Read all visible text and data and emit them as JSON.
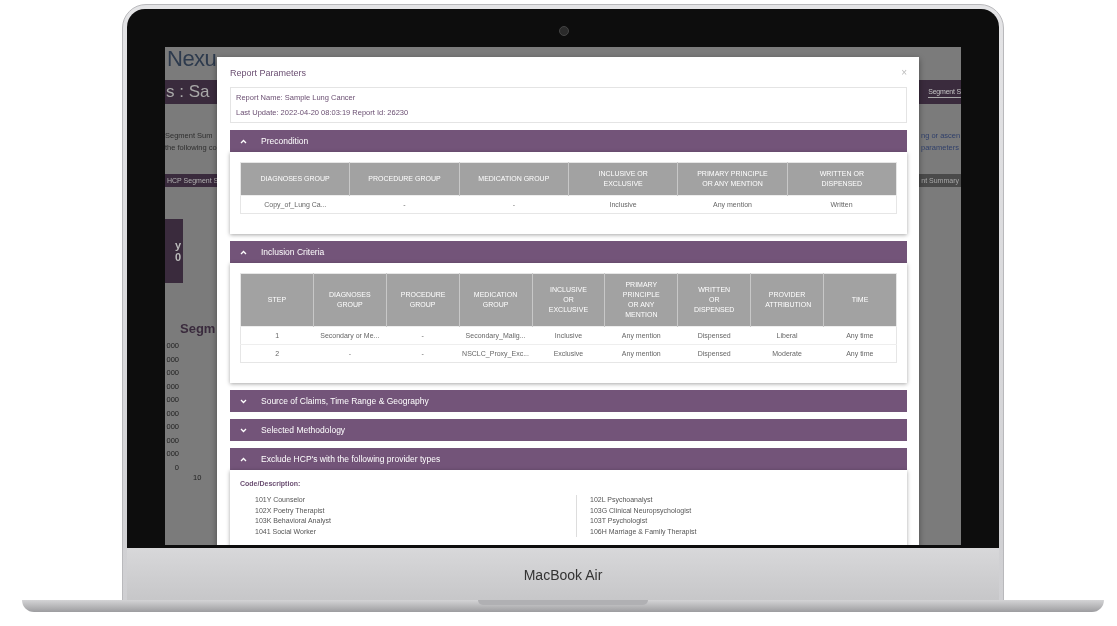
{
  "device": {
    "label": "MacBook Air"
  },
  "background_app": {
    "logo": "Nexu",
    "page_title": "s : Sa",
    "header_tab": "Segment S",
    "left_text": [
      "Segment Sum",
      "the following co"
    ],
    "right_text": [
      "ng or ascen",
      "parameters"
    ],
    "tabs": [
      {
        "label": "HCP Segment S",
        "selected": true
      },
      {
        "label": "nt Summary",
        "selected": false
      }
    ],
    "card_text": [
      "y",
      "0"
    ],
    "section_title": "Segm",
    "axis_labels": [
      "000",
      "000",
      "000",
      "000",
      "000",
      "000",
      "000",
      "000",
      "000",
      "0"
    ],
    "x_label": "10"
  },
  "modal": {
    "title": "Report Parameters",
    "close": "×",
    "report_name": "Report Name: Sample Lung Cancer",
    "last_update": "Last Update: 2022-04-20 08:03:19 Report Id: 26230",
    "sections": [
      {
        "title": "Precondition",
        "expanded": true,
        "kind": "table",
        "columns": [
          "DIAGNOSES GROUP",
          "PROCEDURE GROUP",
          "MEDICATION GROUP",
          "INCLUSIVE OR EXCLUSIVE",
          "PRIMARY PRINCIPLE OR ANY MENTION",
          "WRITTEN OR DISPENSED"
        ],
        "rows": [
          [
            "Copy_of_Lung Ca...",
            "-",
            "-",
            "Inclusive",
            "Any mention",
            "Written"
          ]
        ]
      },
      {
        "title": "Inclusion Criteria",
        "expanded": true,
        "kind": "table",
        "columns": [
          "STEP",
          "DIAGNOSES GROUP",
          "PROCEDURE GROUP",
          "MEDICATION GROUP",
          "INCLUSIVE OR EXCLUSIVE",
          "PRIMARY PRINCIPLE OR ANY MENTION",
          "WRITTEN OR DISPENSED",
          "PROVIDER ATTRIBUTION",
          "TIME"
        ],
        "rows": [
          [
            "1",
            "Secondary or Me...",
            "-",
            "Secondary_Malig...",
            "Inclusive",
            "Any mention",
            "Dispensed",
            "Liberal",
            "Any time"
          ],
          [
            "2",
            "-",
            "-",
            "NSCLC_Proxy_Exc...",
            "Exclusive",
            "Any mention",
            "Dispensed",
            "Moderate",
            "Any time"
          ]
        ]
      },
      {
        "title": "Source of Claims, Time Range & Geography",
        "expanded": false
      },
      {
        "title": "Selected Methodology",
        "expanded": false
      },
      {
        "title": "Exclude HCP's with the following provider types",
        "expanded": true,
        "kind": "list",
        "label": "Code/Description:",
        "lists": [
          [
            "101Y Counselor",
            "102X Poetry Therapist",
            "103K Behavioral Analyst",
            "1041 Social Worker"
          ],
          [
            "102L Psychoanalyst",
            "103G Clinical Neuropsychologist",
            "103T Psychologist",
            "106H Marriage & Family Therapist"
          ]
        ]
      }
    ]
  }
}
